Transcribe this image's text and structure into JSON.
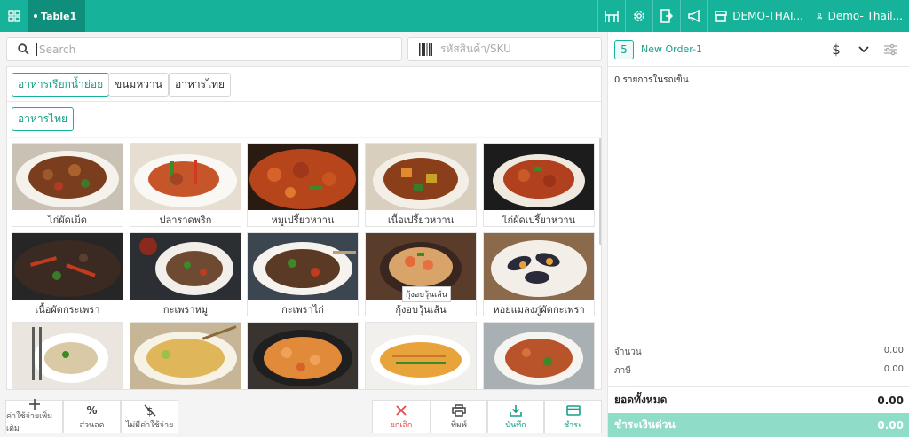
{
  "topbar": {
    "table_tab": "Table1",
    "store_name": "DEMO-THAI...",
    "user_name": "Demo- Thail...",
    "icons": [
      "grid-icon",
      "table-icon",
      "gear-icon",
      "exit-icon",
      "megaphone-icon",
      "store-icon",
      "user-icon"
    ],
    "bg_color": "#16b39a"
  },
  "search": {
    "placeholder": "Search"
  },
  "sku": {
    "placeholder": "รหัสสินค้า/SKU"
  },
  "categories": {
    "row1": [
      "อาหารเรียกน้ำย่อย",
      "ขนมหวาน",
      "อาหารไทย"
    ],
    "row2": [
      "อาหารไทย"
    ],
    "active_color": "#16b39a"
  },
  "products": [
    {
      "name": "ไก่ผัดเม็ด"
    },
    {
      "name": "ปลาราดพริก"
    },
    {
      "name": "หมูเปรี้ยวหวาน"
    },
    {
      "name": "เนื้อเปรี้ยวหวาน"
    },
    {
      "name": "ไก่ผัดเปรี้ยวหวาน"
    },
    {
      "name": "เนื้อผัดกระเพรา"
    },
    {
      "name": "กะเพราหมู"
    },
    {
      "name": "กะเพราไก่"
    },
    {
      "name": "กุ้งอบวุ้นเส้น"
    },
    {
      "name": "หอยแมลงภู่ผัดกะเพรา"
    },
    {
      "name": ""
    },
    {
      "name": ""
    },
    {
      "name": ""
    },
    {
      "name": ""
    },
    {
      "name": ""
    }
  ],
  "tooltip": "กุ้งอบวุ้นเส้น",
  "bottom_actions": {
    "extra_charge": "ค่าใช้จ่ายเพิ่มเติม",
    "discount": "ส่วนลด",
    "no_charge": "ไม่มีค่าใช้จ่าย",
    "cancel": "ยกเลิก",
    "print": "พิมพ์",
    "save": "บันทึก",
    "pay": "ชำระ"
  },
  "order": {
    "number": "5",
    "name": "New Order-1",
    "cart_count": "0 รายการในรถเข็น",
    "quantity_label": "จำนวน",
    "quantity_value": "0.00",
    "tax_label": "ภาษี",
    "tax_value": "0.00",
    "total_label": "ยอดทั้งหมด",
    "total_value": "0.00",
    "quick_pay_label": "ชำระเงินด่วน",
    "quick_pay_value": "0.00"
  }
}
